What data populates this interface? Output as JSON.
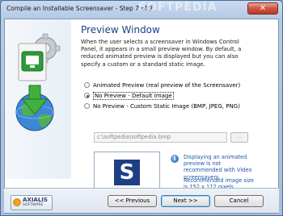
{
  "window": {
    "title": "Compile an Installable Screensaver - Step 7 of 9",
    "watermark": "SOFTPEDIA",
    "close_label": "✕"
  },
  "page": {
    "heading": "Preview Window",
    "intro": "When the user selects a screensaver in Windows Control Panel, it appears in a small preview window. By default, a reduced animated preview is displayed but you can also specify a custom or a standard static image."
  },
  "options": [
    {
      "label": "Animated Preview (real preview of the Screensaver)",
      "selected": false
    },
    {
      "label": "No Preview - Default Image",
      "selected": true
    },
    {
      "label": "No Preview - Custom Static Image (BMP, JPEG, PNG)",
      "selected": false
    }
  ],
  "path_field": {
    "value": "c:\\softpedia\\softpedia.bmp"
  },
  "browse_label": "...",
  "preview": {
    "logo_letter": "S"
  },
  "info": {
    "icon": "i",
    "line1": "Displaying an animated preview is not recommended with Video screensavers.",
    "line2": "Recommended image size is 152 x 112 pixels."
  },
  "footer": {
    "logo_top": "AXIALIS",
    "logo_bottom": "SOFTWARE",
    "back_label": "<< Previous",
    "next_label": "Next >>",
    "cancel_label": "Cancel"
  }
}
